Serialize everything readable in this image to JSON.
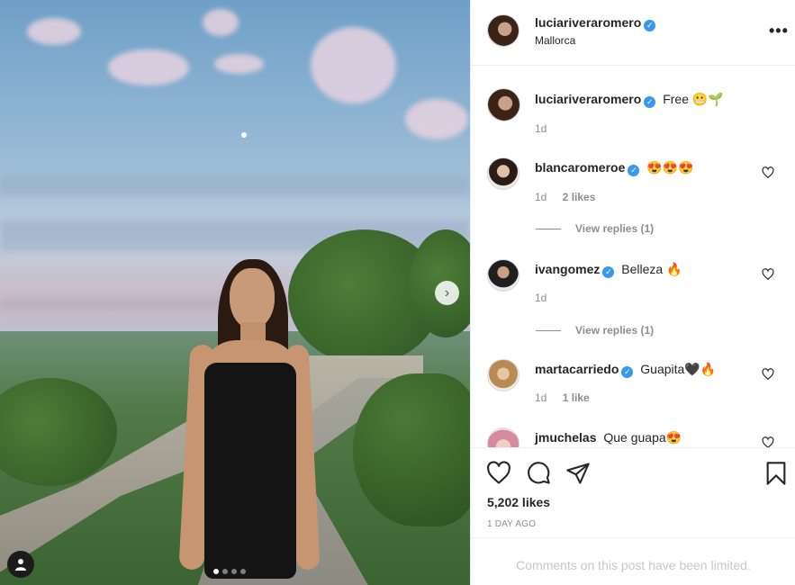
{
  "post": {
    "author": "luciariveraromero",
    "location": "Mallorca",
    "verified_mark": "✓",
    "more_label": "•••",
    "photo": {
      "nav_next_glyph": "›",
      "carousel": {
        "count": 4,
        "active_index": 1
      }
    }
  },
  "caption": {
    "username": "luciariveraromero",
    "text": "Free 😬🌱",
    "time": "1d"
  },
  "comments": [
    {
      "username": "blancaromeroe",
      "text": "😍😍😍",
      "time": "1d",
      "likes": "2 likes",
      "replies": "View replies (1)"
    },
    {
      "username": "ivangomez",
      "text": "Belleza 🔥",
      "time": "1d",
      "likes": "",
      "replies": "View replies (1)"
    },
    {
      "username": "martacarriedo",
      "text": "Guapita🖤🔥",
      "time": "1d",
      "likes": "1 like",
      "replies": ""
    },
    {
      "username": "jmuchelas",
      "text": "Que guapa😍",
      "time": "",
      "likes": "",
      "replies": ""
    }
  ],
  "actions": {
    "icons": [
      "heart-icon",
      "comment-icon",
      "share-icon",
      "save-icon"
    ],
    "likes": "5,202 likes",
    "timestamp": "1 DAY AGO"
  },
  "footer": {
    "limited_notice": "Comments on this post have been limited."
  },
  "colors": {
    "verified": "#3897f0",
    "muted_text": "#8e8e8e",
    "border": "#efefef"
  }
}
